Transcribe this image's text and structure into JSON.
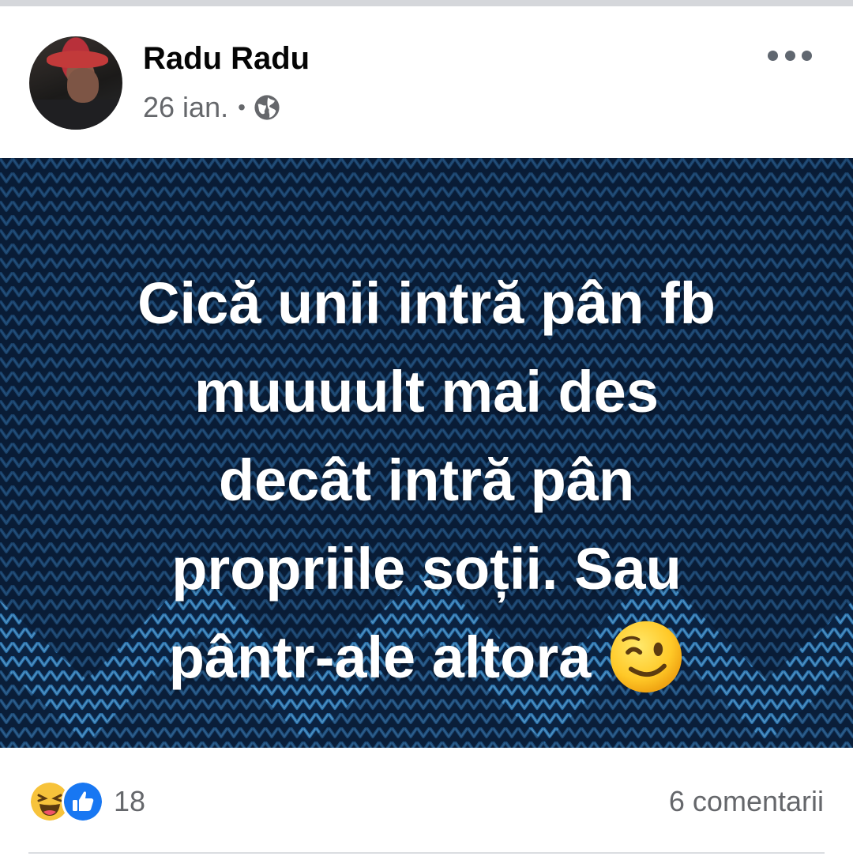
{
  "post": {
    "author": "Radu Radu",
    "date": "26 ian.",
    "separator": "•",
    "audience_icon": "globe-icon",
    "text_lines": [
      "Cică unii intră pân fb",
      "muuuult mai des",
      "decât intră pân",
      "propriile soții. Sau",
      "pântr-ale altora"
    ],
    "text_emoji": "winking-face-emoji",
    "background_color": "#0c2342",
    "accent_knit_color": "#1e6fb5"
  },
  "footer": {
    "reactions": [
      "haha-icon",
      "like-icon"
    ],
    "reaction_count": "18",
    "comments_label": "6 comentarii"
  }
}
